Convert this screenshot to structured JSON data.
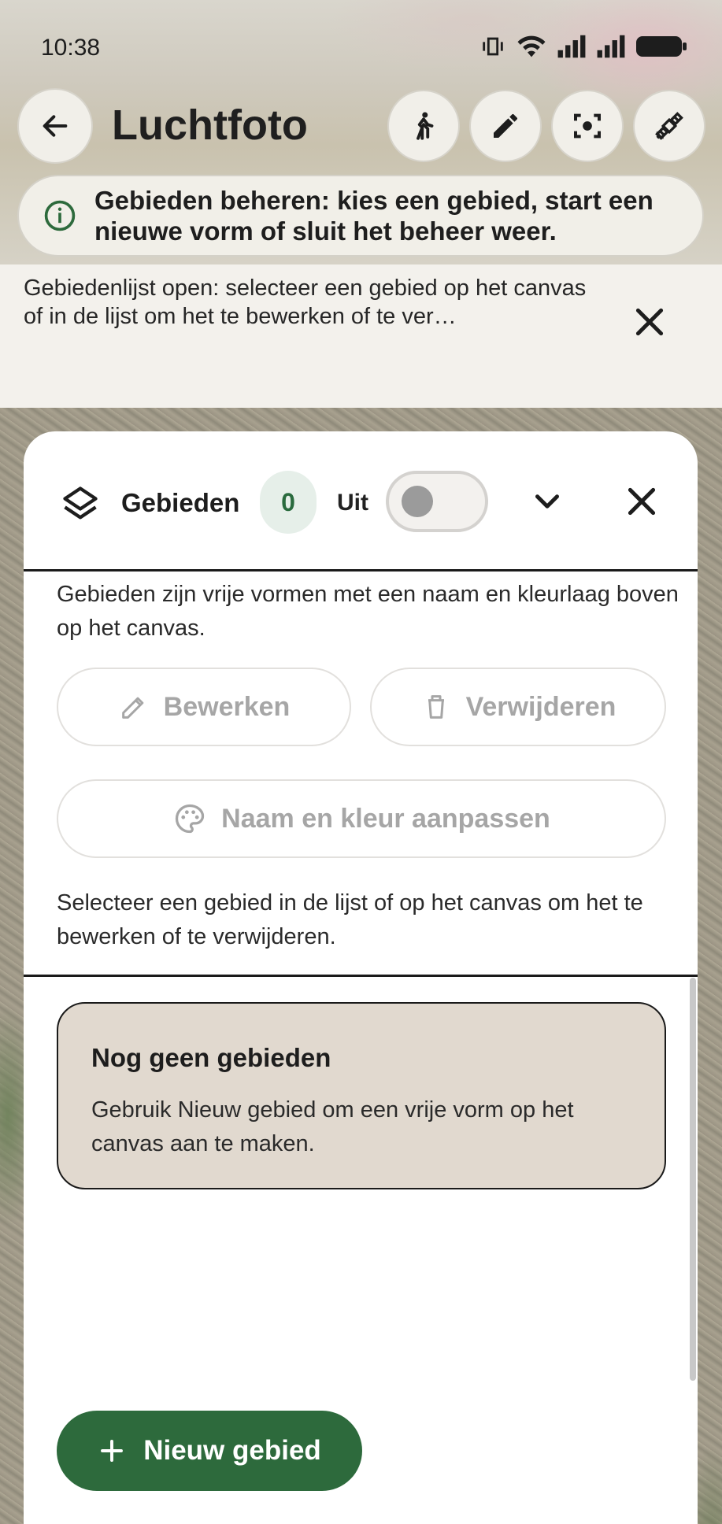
{
  "status_bar": {
    "time": "10:38",
    "icons": [
      "vibrate-icon",
      "wifi-icon",
      "signal-icon",
      "signal-icon",
      "battery-icon"
    ]
  },
  "app_bar": {
    "title": "Luchtfoto",
    "actions": [
      "walk-icon",
      "pencil-icon",
      "focus-icon",
      "satellite-icon"
    ]
  },
  "info_pill": {
    "text": "Gebieden beheren: kies een gebied, start een nieuwe vorm of sluit het beheer weer."
  },
  "banner": {
    "text": "Gebiedenlijst open: selecteer een gebied op het canvas of in de lijst om het te bewerken of te ver…"
  },
  "panel": {
    "title": "Gebieden",
    "count": "0",
    "toggle_label": "Uit",
    "toggle_on": false,
    "description": "Gebieden zijn vrije vormen met een naam en kleurlaag boven op het canvas.",
    "edit_button": "Bewerken",
    "delete_button": "Verwijderen",
    "rename_button": "Naam en kleur aanpassen",
    "hint": "Selecteer een gebied in de lijst of op het canvas om het te bewerken of te verwijderen.",
    "empty_state": {
      "title": "Nog geen gebieden",
      "body": "Gebruik Nieuw gebied om een vrije vorm op het canvas aan te maken."
    },
    "new_button": "Nieuw gebied"
  },
  "colors": {
    "primary": "#2d6a3c",
    "badge_bg": "#e6efe9",
    "card_bg": "#e1d9cf",
    "disabled_text": "#a6a6a6"
  }
}
